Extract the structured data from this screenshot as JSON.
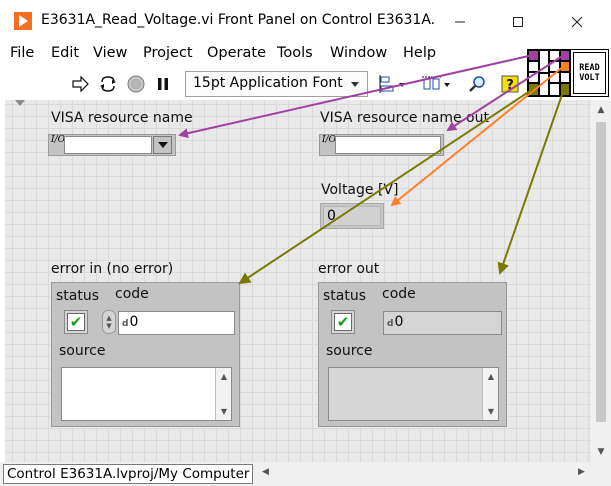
{
  "window": {
    "title": "E3631A_Read_Voltage.vi Front Panel on Control E3631A...",
    "minimize_glyph": "—",
    "maximize_glyph": "☐",
    "close_glyph": "✕"
  },
  "menu": [
    "File",
    "Edit",
    "View",
    "Project",
    "Operate",
    "Tools",
    "Window",
    "Help"
  ],
  "toolbar": {
    "font_select": "15pt Application Font",
    "icons": [
      "run-arrow-icon",
      "run-continuously-icon",
      "abort-icon",
      "pause-icon",
      "align-objects-icon",
      "distribute-objects-icon",
      "search-icon",
      "help-icon"
    ]
  },
  "vi_icon": {
    "line1": "READ",
    "line2": "VOLT"
  },
  "controls": {
    "visa_in_label": "VISA resource name",
    "visa_out_label": "VISA resource name out",
    "visa_io_glyph": "I/O",
    "voltage_label": "Voltage [V]",
    "voltage_value": "0",
    "error_in": {
      "label": "error in (no error)",
      "status_label": "status",
      "status_glyph": "✔",
      "code_label": "code",
      "code_value": "0",
      "source_label": "source"
    },
    "error_out": {
      "label": "error out",
      "status_label": "status",
      "status_glyph": "✔",
      "code_label": "code",
      "code_value": "0",
      "source_label": "source"
    }
  },
  "statusbar": {
    "path": "Control E3631A.lvproj/My Computer"
  },
  "colors": {
    "visa_wire": "#a040a0",
    "error_wire": "#7a7a00",
    "numeric_wire": "#ff7f27",
    "status_ok": "#17a217"
  }
}
